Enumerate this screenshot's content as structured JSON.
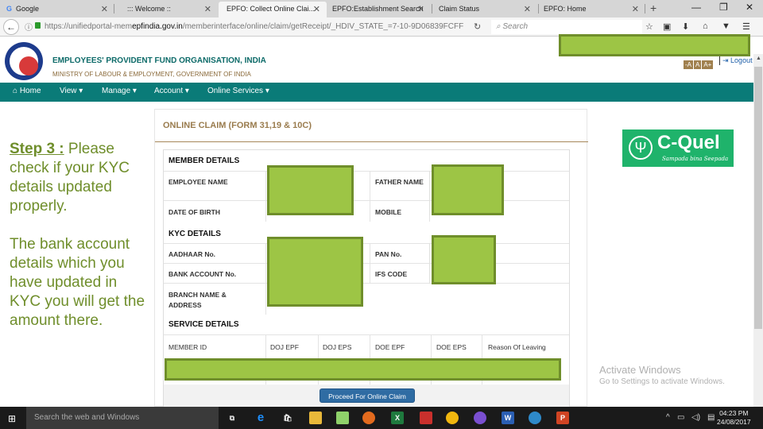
{
  "browser": {
    "tabs": [
      {
        "label": "Google",
        "favicon": "google-g-icon",
        "active": false
      },
      {
        "label": "::: Welcome ::",
        "active": false
      },
      {
        "label": "EPFO: Collect Online Clai...",
        "active": true
      },
      {
        "label": "EPFO:Establishment Search",
        "active": false
      },
      {
        "label": "Claim Status",
        "active": false
      },
      {
        "label": "EPFO: Home",
        "active": false
      }
    ],
    "new_tab": "+",
    "window_controls": {
      "minimize": "—",
      "maximize": "❐",
      "close": "✕"
    },
    "url": {
      "prefix": "https://unifiedportal-mem",
      "domain": "epfindia.gov.in",
      "suffix": "/memberinterface/online/claim/getReceipt/_HDIV_STATE_=7-10-9D06839FCFF"
    },
    "search_placeholder": "Search",
    "toolbar_icons": [
      "star-icon",
      "clipboard-icon",
      "download-icon",
      "home-icon",
      "pocket-icon",
      "menu-icon"
    ]
  },
  "site": {
    "org_name": "EMPLOYEES' PROVIDENT FUND ORGANISATION, INDIA",
    "ministry": "MINISTRY OF LABOUR & EMPLOYMENT, GOVERNMENT OF INDIA",
    "font_buttons": [
      "-A",
      "A",
      "A+"
    ],
    "logout": "Logout",
    "nav": [
      {
        "label": "Home",
        "icon": "home-icon"
      },
      {
        "label": "View",
        "dropdown": true
      },
      {
        "label": "Manage",
        "dropdown": true
      },
      {
        "label": "Account",
        "dropdown": true
      },
      {
        "label": "Online Services",
        "dropdown": true
      }
    ]
  },
  "instruction": {
    "step": "Step 3 :",
    "para1": " Please check if your KYC details updated properly.",
    "para2": "The bank account details which you have updated in KYC you will get the amount there."
  },
  "claim": {
    "title": "ONLINE CLAIM (FORM 31,19 & 10C)",
    "member_details": "MEMBER DETAILS",
    "employee_name": "EMPLOYEE NAME",
    "father_name": "FATHER NAME",
    "dob": "DATE OF BIRTH",
    "mobile": "MOBILE",
    "kyc_details": "KYC DETAILS",
    "aadhaar": "AADHAAR No.",
    "pan": "PAN No.",
    "bank_account": "BANK ACCOUNT No.",
    "ifs_code": "IFS CODE",
    "branch_line1": "BRANCH NAME &",
    "branch_line2": "ADDRESS",
    "service_details": "SERVICE DETAILS",
    "service_columns": [
      "MEMBER ID",
      "DOJ EPF",
      "DOJ EPS",
      "DOE EPF",
      "DOE EPS",
      "Reason Of Leaving"
    ],
    "proceed_button": "Proceed For Online Claim"
  },
  "branding": {
    "name": "C-Quel",
    "tagline": "Sampada bina Seepada",
    "color": "#1fb36b"
  },
  "watermark": {
    "line1": "Activate Windows",
    "line2": "Go to Settings to activate Windows."
  },
  "taskbar": {
    "search_placeholder": "Search the web and Windows",
    "time": "04:23 PM",
    "date": "24/08/2017"
  },
  "colors": {
    "teal_nav": "#0a7b78",
    "redaction": "#9dc545",
    "instruction_text": "#6f8e2b",
    "panel_title": "#9a7c4e",
    "button_blue": "#2f6ca3"
  }
}
